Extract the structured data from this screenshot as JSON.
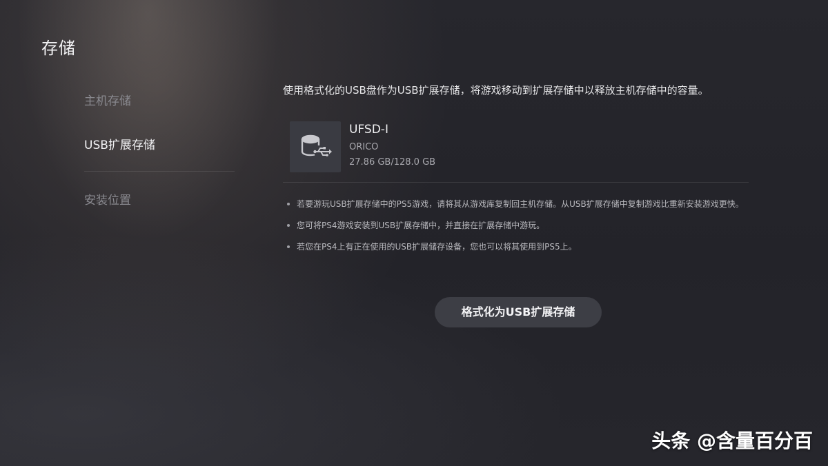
{
  "header": {
    "title": "存储"
  },
  "sidebar": {
    "items": [
      {
        "label": "主机存储"
      },
      {
        "label": "USB扩展存储"
      },
      {
        "label": "安装位置"
      }
    ]
  },
  "main": {
    "description": "使用格式化的USB盘作为USB扩展存储，将游戏移动到扩展存储中以释放主机存储中的容量。",
    "device": {
      "icon": "usb-drive-icon",
      "name": "UFSD-I",
      "brand": "ORICO",
      "capacity": "27.86 GB/128.0 GB"
    },
    "notes": [
      "若要游玩USB扩展存储中的PS5游戏，请将其从游戏库复制回主机存储。从USB扩展存储中复制游戏比重新安装游戏更快。",
      "您可将PS4游戏安装到USB扩展存储中，并直接在扩展存储中游玩。",
      "若您在PS4上有正在使用的USB扩展储存设备，您也可以将其使用到PS5上。"
    ],
    "format_button_label": "格式化为USB扩展存储"
  },
  "watermark": "头条 @含量百分百",
  "colors": {
    "background": "#23242b",
    "button": "#3d3e45",
    "icon_box": "#3a3b42"
  }
}
